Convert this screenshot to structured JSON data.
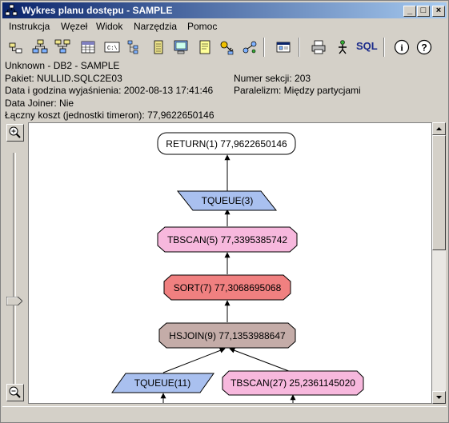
{
  "window": {
    "title": "Wykres planu dostępu - SAMPLE",
    "controls": {
      "minimize": "_",
      "maximize": "□",
      "close": "×"
    }
  },
  "menu": [
    {
      "label": "Instrukcja"
    },
    {
      "label": "Węzeł"
    },
    {
      "label": "Widok"
    },
    {
      "label": "Narzędzia"
    },
    {
      "label": "Pomoc"
    }
  ],
  "toolbar": {
    "icons": [
      "open-icon",
      "expand-icon",
      "collapse-icon",
      "table-icon",
      "command-icon",
      "tree-icon",
      "list-icon",
      "monitor-icon",
      "notes-icon",
      "key-icon",
      "connect-icon",
      "nav-left-icon",
      "details-icon",
      "nav-left-icon",
      "print-icon",
      "run-icon",
      "sql-icon",
      "info-icon",
      "help-icon"
    ],
    "sql_label": "SQL",
    "info_label": "i",
    "help_label": "?"
  },
  "info": {
    "line1": "Unknown - DB2 - SAMPLE",
    "package": "Pakiet: NULLID.SQLC2E03",
    "section": "Numer sekcji: 203",
    "explain_time": "Data i godzina wyjaśnienia: 2002-08-13 17:41:46",
    "parallelism": "Paralelizm: Między partycjami",
    "joiner": "Data Joiner: Nie",
    "total_cost": "Łączny koszt (jednostki timeron): 77,9622650146"
  },
  "graph": {
    "nodes": [
      {
        "id": "return",
        "label": "RETURN(1) 77,9622650146",
        "shape": "rounded",
        "fill": "#ffffff"
      },
      {
        "id": "tqueue3",
        "label": "TQUEUE(3)",
        "shape": "parallelogram",
        "fill": "#a9c0ef"
      },
      {
        "id": "tbscan5",
        "label": "TBSCAN(5) 77,3395385742",
        "shape": "octagon",
        "fill": "#f7b8dd"
      },
      {
        "id": "sort7",
        "label": "SORT(7) 77,3068695068",
        "shape": "octagon",
        "fill": "#f08080"
      },
      {
        "id": "hsjoin9",
        "label": "HSJOIN(9) 77,1353988647",
        "shape": "octagon",
        "fill": "#c4aca8"
      },
      {
        "id": "tqueue11",
        "label": "TQUEUE(11)",
        "shape": "parallelogram",
        "fill": "#a9c0ef"
      },
      {
        "id": "tbscan27",
        "label": "TBSCAN(27) 25,2361145020",
        "shape": "octagon",
        "fill": "#f7b8dd"
      }
    ]
  }
}
